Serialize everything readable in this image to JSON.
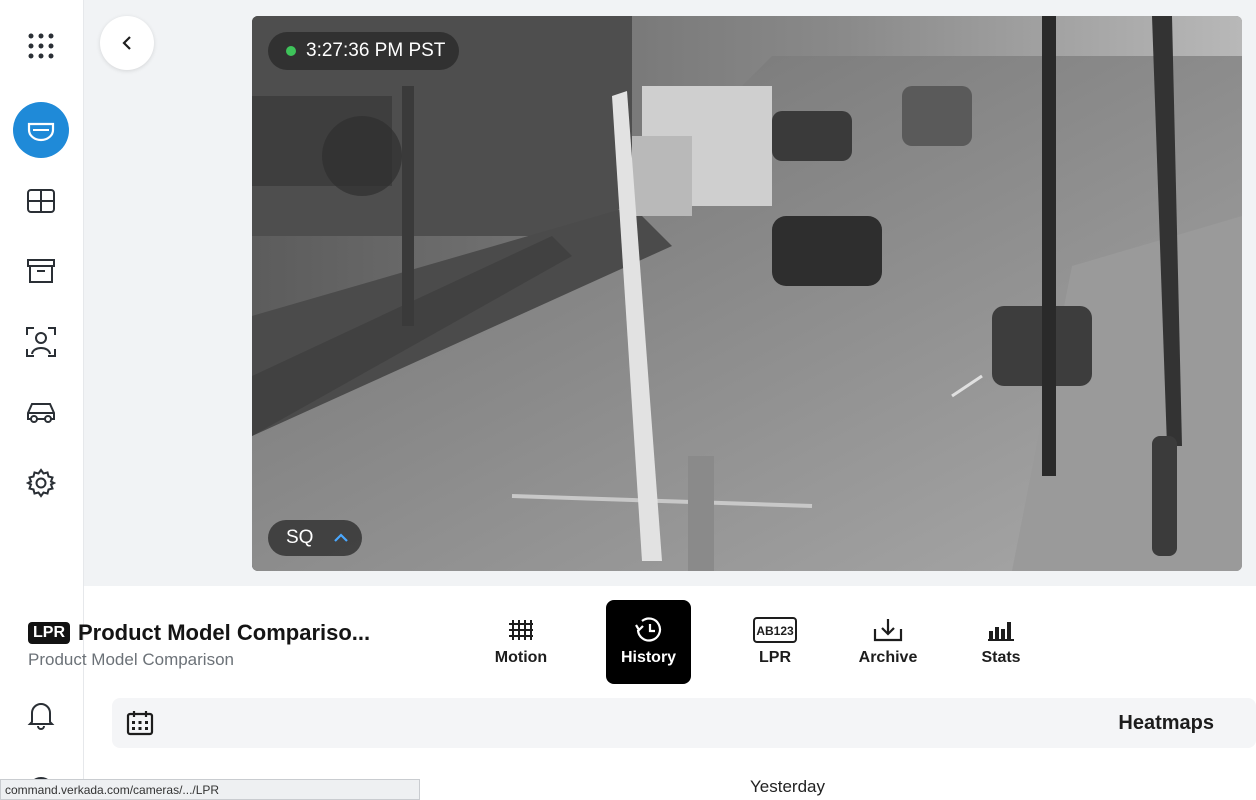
{
  "video": {
    "timestamp": "3:27:36 PM PST",
    "quality": "SQ",
    "live_dot_color": "#3ec35a"
  },
  "camera": {
    "badge": "LPR",
    "name": "Product Model Compariso...",
    "site": "Product Model Comparison"
  },
  "tabs": [
    {
      "label": "Motion",
      "icon": "motion-grid-icon"
    },
    {
      "label": "History",
      "icon": "history-clock-icon",
      "active": true
    },
    {
      "label": "LPR",
      "icon": "license-plate-icon",
      "plate_text": "AB123"
    },
    {
      "label": "Archive",
      "icon": "archive-download-icon"
    },
    {
      "label": "Stats",
      "icon": "bar-chart-icon"
    }
  ],
  "heatmaps": {
    "label": "Heatmaps",
    "date_label": "Yesterday"
  },
  "sidebar": {
    "items": [
      "apps-grid-icon",
      "camera-dome-icon",
      "grid-view-icon",
      "archive-box-icon",
      "person-frame-icon",
      "vehicle-icon",
      "settings-gear-icon",
      "bell-icon"
    ],
    "accent": "#1f8ad8"
  },
  "status_bar": {
    "url": "command.verkada.com/cameras/.../LPR"
  }
}
